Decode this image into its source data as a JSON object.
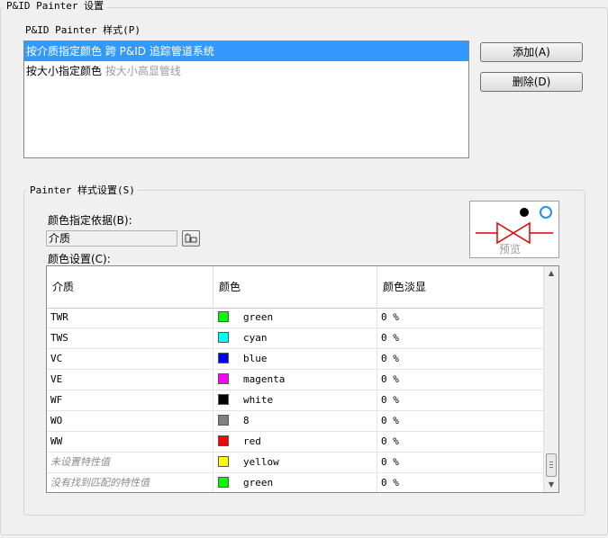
{
  "window": {
    "title": "P&ID Painter 设置"
  },
  "styles_group": {
    "label": "P&ID Painter 样式(P)",
    "items": [
      {
        "name": "按介质指定颜色",
        "desc": "跨 P&ID 追踪管道系统",
        "selected": true
      },
      {
        "name": "按大小指定颜色",
        "desc": "按大小高显管线",
        "selected": false
      }
    ],
    "add_label": "添加(A)",
    "delete_label": "删除(D)"
  },
  "painter_group": {
    "label": "Painter 样式设置(S)",
    "basis_label": "颜色指定依据(B):",
    "basis_value": "介质",
    "preview_label": "预览",
    "color_settings_label": "颜色设置(C):",
    "columns": [
      "介质",
      "颜色",
      "颜色淡显"
    ],
    "rows": [
      {
        "medium": "TWR",
        "color_name": "green",
        "color_hex": "#00ff00",
        "fade": "0 %",
        "italic": false
      },
      {
        "medium": "TWS",
        "color_name": "cyan",
        "color_hex": "#00ffff",
        "fade": "0 %",
        "italic": false
      },
      {
        "medium": "VC",
        "color_name": "blue",
        "color_hex": "#0000ff",
        "fade": "0 %",
        "italic": false
      },
      {
        "medium": "VE",
        "color_name": "magenta",
        "color_hex": "#ff00ff",
        "fade": "0 %",
        "italic": false
      },
      {
        "medium": "WF",
        "color_name": "white",
        "color_hex": "#000000",
        "fade": "0 %",
        "italic": false
      },
      {
        "medium": "WO",
        "color_name": "8",
        "color_hex": "#808080",
        "fade": "0 %",
        "italic": false
      },
      {
        "medium": "WW",
        "color_name": "red",
        "color_hex": "#ff0000",
        "fade": "0 %",
        "italic": false
      },
      {
        "medium": "未设置特性值",
        "color_name": "yellow",
        "color_hex": "#ffff00",
        "fade": "0 %",
        "italic": true
      },
      {
        "medium": "没有找到匹配的特性值",
        "color_name": "green",
        "color_hex": "#00ff00",
        "fade": "0 %",
        "italic": true
      }
    ]
  },
  "icons": {
    "pick": "pick-property-icon",
    "valve": "valve-preview-icon",
    "scroll_up": "scroll-up-icon",
    "scroll_down": "scroll-down-icon"
  },
  "colors": {
    "selection": "#3399ff",
    "preview_red": "#e00000",
    "preview_blue": "#1e90ff"
  }
}
